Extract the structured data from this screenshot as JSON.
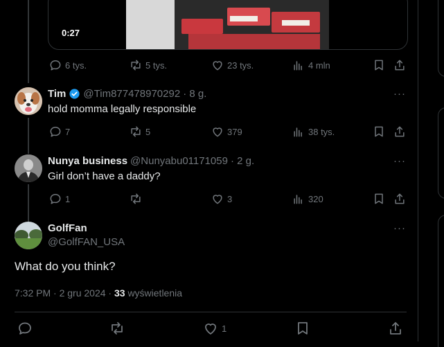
{
  "video": {
    "duration": "0:27"
  },
  "main_tweet_metrics": {
    "replies": "6 tys.",
    "reposts": "5 tys.",
    "likes": "23 tys.",
    "views": "4 mln"
  },
  "replies": [
    {
      "name": "Tim",
      "handle": "@Tim877478970292",
      "time": "· 8 g.",
      "text": "hold momma legally responsible",
      "replies": "7",
      "reposts": "5",
      "likes": "379",
      "views": "38 tys.",
      "verified": true
    },
    {
      "name": "Nunya business",
      "handle": "@Nunyabu01171059",
      "time": "· 2 g.",
      "text": "Girl don’t have a daddy?",
      "replies": "1",
      "reposts": "",
      "likes": "3",
      "views": "320",
      "verified": false
    }
  ],
  "focused": {
    "name": "GolfFan",
    "handle": "@GolfFAN_USA",
    "text": "What do you think?",
    "timestamp": "7:32 PM · 2 gru 2024 · ",
    "views_count": "33",
    "views_label": "wyświetlenia",
    "likes": "1"
  },
  "more_label": "···",
  "colors": {
    "accent": "#1d9bf0",
    "gray": "#71767b",
    "border": "#2f3336"
  }
}
